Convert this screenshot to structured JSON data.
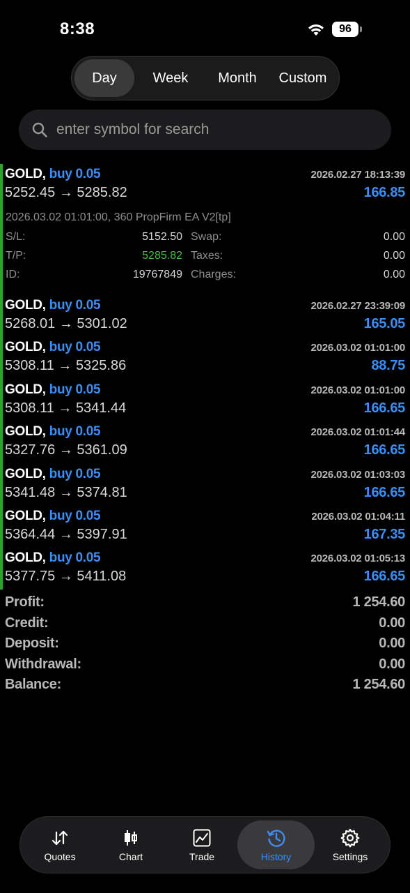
{
  "status": {
    "time": "8:38",
    "battery": "96",
    "icons": [
      "wifi-icon",
      "battery-icon"
    ]
  },
  "period_tabs": [
    {
      "label": "Day",
      "active": true
    },
    {
      "label": "Week",
      "active": false
    },
    {
      "label": "Month",
      "active": false
    },
    {
      "label": "Custom",
      "active": false
    }
  ],
  "search": {
    "placeholder": "enter symbol for search",
    "value": ""
  },
  "trades": [
    {
      "symbol": "GOLD,",
      "side": "buy 0.05",
      "datetime": "2026.02.27 18:13:39",
      "open": "5252.45",
      "arrow": "→",
      "close": "5285.82",
      "profit": "166.85",
      "expanded": true,
      "details": {
        "comment": "2026.03.02 01:01:00, 360 PropFirm EA V2[tp]",
        "sl_label": "S/L:",
        "sl": "5152.50",
        "tp_label": "T/P:",
        "tp": "5285.82",
        "id_label": "ID:",
        "id": "19767849",
        "swap_label": "Swap:",
        "swap": "0.00",
        "taxes_label": "Taxes:",
        "taxes": "0.00",
        "charges_label": "Charges:",
        "charges": "0.00"
      }
    },
    {
      "symbol": "GOLD,",
      "side": "buy 0.05",
      "datetime": "2026.02.27 23:39:09",
      "open": "5268.01",
      "arrow": "→",
      "close": "5301.02",
      "profit": "165.05"
    },
    {
      "symbol": "GOLD,",
      "side": "buy 0.05",
      "datetime": "2026.03.02 01:01:00",
      "open": "5308.11",
      "arrow": "→",
      "close": "5325.86",
      "profit": "88.75"
    },
    {
      "symbol": "GOLD,",
      "side": "buy 0.05",
      "datetime": "2026.03.02 01:01:00",
      "open": "5308.11",
      "arrow": "→",
      "close": "5341.44",
      "profit": "166.65"
    },
    {
      "symbol": "GOLD,",
      "side": "buy 0.05",
      "datetime": "2026.03.02 01:01:44",
      "open": "5327.76",
      "arrow": "→",
      "close": "5361.09",
      "profit": "166.65"
    },
    {
      "symbol": "GOLD,",
      "side": "buy 0.05",
      "datetime": "2026.03.02 01:03:03",
      "open": "5341.48",
      "arrow": "→",
      "close": "5374.81",
      "profit": "166.65"
    },
    {
      "symbol": "GOLD,",
      "side": "buy 0.05",
      "datetime": "2026.03.02 01:04:11",
      "open": "5364.44",
      "arrow": "→",
      "close": "5397.91",
      "profit": "167.35"
    },
    {
      "symbol": "GOLD,",
      "side": "buy 0.05",
      "datetime": "2026.03.02 01:05:13",
      "open": "5377.75",
      "arrow": "→",
      "close": "5411.08",
      "profit": "166.65"
    }
  ],
  "summary": [
    {
      "label": "Profit:",
      "value": "1 254.60"
    },
    {
      "label": "Credit:",
      "value": "0.00"
    },
    {
      "label": "Deposit:",
      "value": "0.00"
    },
    {
      "label": "Withdrawal:",
      "value": "0.00"
    },
    {
      "label": "Balance:",
      "value": "1 254.60"
    }
  ],
  "tabbar": [
    {
      "label": "Quotes",
      "icon": "quotes-arrows-icon",
      "active": false
    },
    {
      "label": "Chart",
      "icon": "candlestick-icon",
      "active": false
    },
    {
      "label": "Trade",
      "icon": "trade-chart-icon",
      "active": false
    },
    {
      "label": "History",
      "icon": "history-clock-icon",
      "active": true
    },
    {
      "label": "Settings",
      "icon": "gear-icon",
      "active": false
    }
  ],
  "colors": {
    "accent": "#3b8ef5",
    "positive": "#3fbf3f",
    "bar": "#2aa52a",
    "background": "#000000"
  }
}
